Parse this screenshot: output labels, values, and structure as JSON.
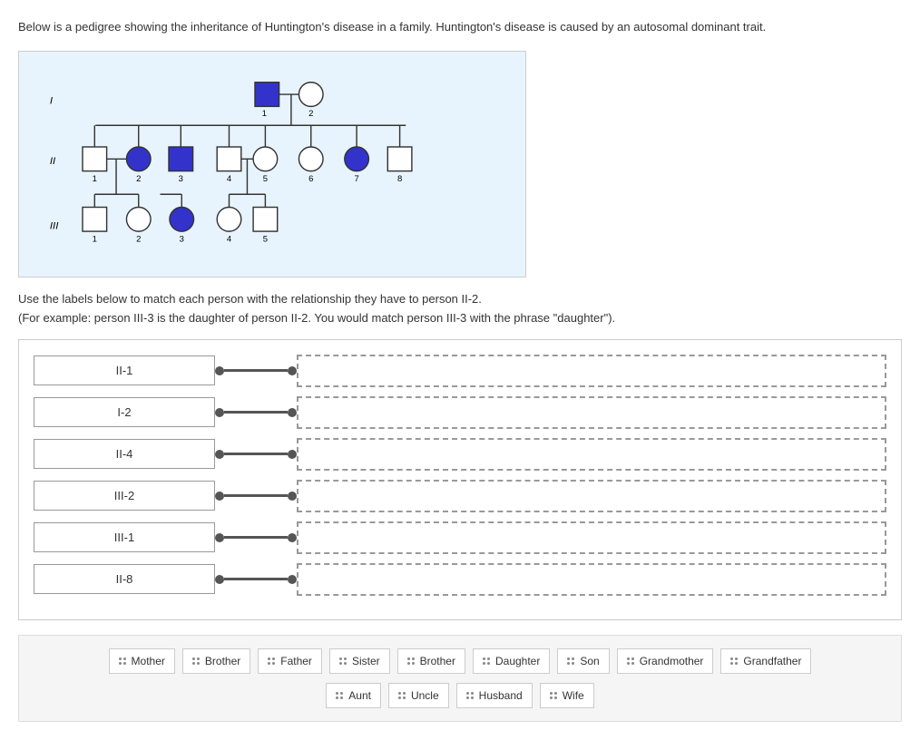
{
  "intro": {
    "text": "Below is a pedigree showing the inheritance of Huntington's disease in a family. Huntington's disease is caused by an autosomal dominant trait."
  },
  "instructions": {
    "line1": "Use the labels below to match each person with the relationship they have to person II-2.",
    "line2": "(For example: person III-3 is the daughter of person II-2. You would match person III-3 with the phrase \"daughter\")."
  },
  "matchRows": [
    {
      "id": "II-1",
      "label": "II-1"
    },
    {
      "id": "I-2",
      "label": "I-2"
    },
    {
      "id": "II-4",
      "label": "II-4"
    },
    {
      "id": "III-2",
      "label": "III-2"
    },
    {
      "id": "III-1",
      "label": "III-1"
    },
    {
      "id": "II-8",
      "label": "II-8"
    }
  ],
  "labelChips": {
    "row1": [
      "Mother",
      "Brother",
      "Father",
      "Sister",
      "Brother",
      "Daughter",
      "Son",
      "Grandmother",
      "Grandfather"
    ],
    "row2": [
      "Aunt",
      "Uncle",
      "Husband",
      "Wife"
    ]
  }
}
